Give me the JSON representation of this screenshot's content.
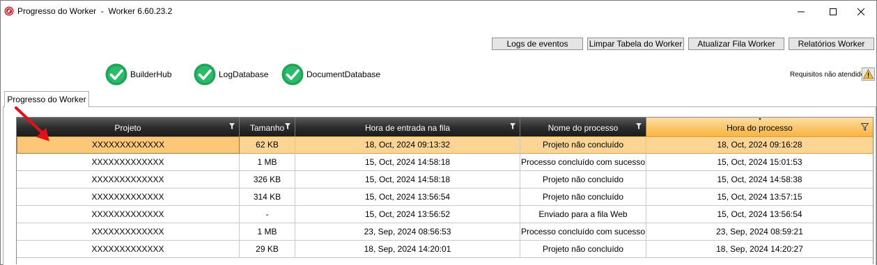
{
  "window": {
    "title": "Progresso do Worker  -  Worker 6.60.23.2",
    "controls": [
      "minimize-icon",
      "maximize-icon",
      "close-icon"
    ]
  },
  "toolbar": {
    "logs_label": "Logs de eventos",
    "clear_label": "Limpar Tabela do Worker",
    "update_label": "Atualizar Fila Worker",
    "reports_label": "Relatórios Worker"
  },
  "services": [
    {
      "name": "BuilderHub",
      "status": "ok"
    },
    {
      "name": "LogDatabase",
      "status": "ok"
    },
    {
      "name": "DocumentDatabase",
      "status": "ok"
    }
  ],
  "requirements": {
    "label": "Requisitos não atendidos",
    "icon": "warning-icon"
  },
  "tabs": [
    {
      "label": "Progresso do Worker",
      "active": true
    }
  ],
  "table": {
    "columns": [
      "Projeto",
      "Tamanho",
      "Hora de entrada na fila",
      "Nome do processo",
      "Hora do processo"
    ],
    "sorted_column": "Hora do processo",
    "rows": [
      {
        "projeto": "XXXXXXXXXXXXX",
        "tamanho": "62 KB",
        "entrada": "18, Oct, 2024 09:13:32",
        "processo": "Projeto não concluído",
        "hora": "18, Oct, 2024 09:16:28",
        "selected": true
      },
      {
        "projeto": "XXXXXXXXXXXXX",
        "tamanho": "1 MB",
        "entrada": "15, Oct, 2024 14:58:18",
        "processo": "Processo concluído com sucesso",
        "hora": "15, Oct, 2024 15:01:53"
      },
      {
        "projeto": "XXXXXXXXXXXXX",
        "tamanho": "326 KB",
        "entrada": "15, Oct, 2024 14:58:18",
        "processo": "Projeto não concluído",
        "hora": "15, Oct, 2024 14:58:38"
      },
      {
        "projeto": "XXXXXXXXXXXXX",
        "tamanho": "314 KB",
        "entrada": "15, Oct, 2024 13:56:54",
        "processo": "Projeto não concluído",
        "hora": "15, Oct, 2024 13:57:15"
      },
      {
        "projeto": "XXXXXXXXXXXXX",
        "tamanho": "-",
        "entrada": "15, Oct, 2024 13:56:52",
        "processo": "Enviado para a fila Web",
        "hora": "15, Oct, 2024 13:56:54"
      },
      {
        "projeto": "XXXXXXXXXXXXX",
        "tamanho": "1 MB",
        "entrada": "23, Sep, 2024 08:56:53",
        "processo": "Processo concluído com sucesso",
        "hora": "23, Sep, 2024 08:59:21"
      },
      {
        "projeto": "XXXXXXXXXXXXX",
        "tamanho": "29 KB",
        "entrada": "18, Sep, 2024 14:20:01",
        "processo": "Projeto não concluído",
        "hora": "18, Sep, 2024 14:20:27"
      }
    ]
  },
  "colors": {
    "accent_header": "#f9b443",
    "selected_row": "#fcd594",
    "check_green": "#1fa55a",
    "annotation_arrow": "#e3101a"
  }
}
